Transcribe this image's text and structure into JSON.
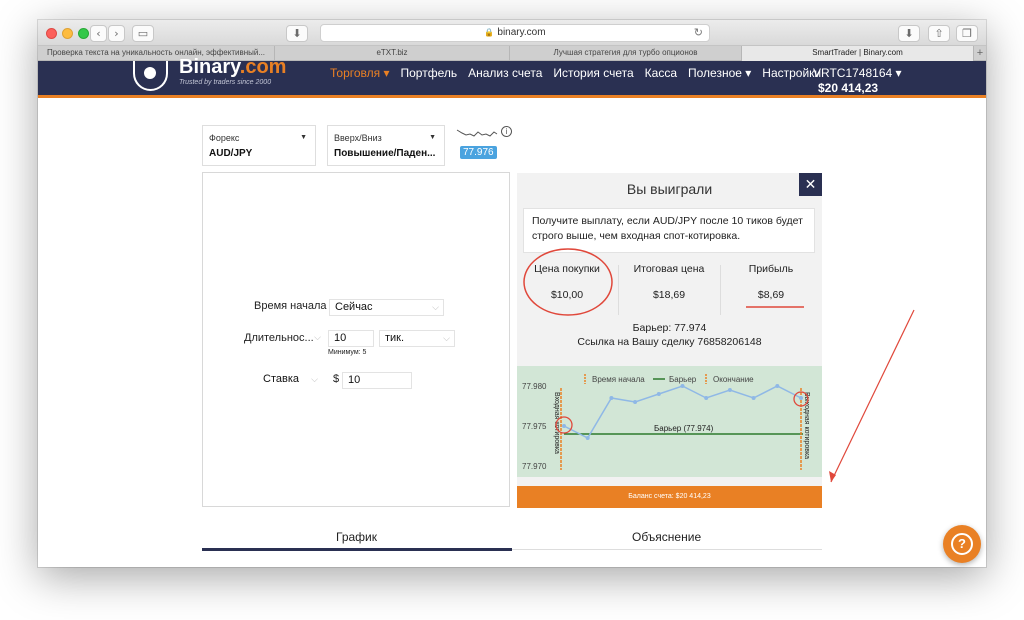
{
  "browser": {
    "address": "binary.com",
    "tabs": [
      {
        "label": "Проверка текста на уникальность онлайн, эффективный..."
      },
      {
        "label": "eTXT.biz"
      },
      {
        "label": "Лучшая стратегия для турбо опционов"
      },
      {
        "label": "SmartTrader | Binary.com"
      }
    ]
  },
  "header": {
    "brand": "Binary",
    "brand_suffix": ".com",
    "tagline": "Trusted by traders since 2000",
    "nav": [
      "Торговля ▾",
      "Портфель",
      "Анализ счета",
      "История счета",
      "Касса",
      "Полезное ▾",
      "Настройки"
    ],
    "account_id": "VRTC1748164  ▾",
    "balance": "$20 414,23"
  },
  "trade": {
    "market_label": "Форекс",
    "market_value": "AUD/JPY",
    "type_label": "Вверх/Вниз",
    "type_value": "Повышение/Паден...",
    "spot": "77.976",
    "start_label": "Время начала",
    "start_value": "Сейчас",
    "duration_label": "Длительнос...",
    "duration_value": "10",
    "duration_unit": "тик.",
    "minimum": "Минимум: 5",
    "stake_label": "Ставка",
    "currency": "$",
    "stake_value": "10"
  },
  "result": {
    "title": "Вы выиграли",
    "close": "✕",
    "description": "Получите выплату, если AUD/JPY после 10 тиков будет строго выше, чем входная спот-котировка.",
    "purchase_label": "Цена покупки",
    "purchase_value": "$10,00",
    "final_label": "Итоговая цена",
    "final_value": "$18,69",
    "profit_label": "Прибыль",
    "profit_value": "$8,69",
    "barrier": "Барьер: 77.974",
    "contract": "Ссылка на Вашу сделку 76858206148",
    "balance_bar": "Баланс счета: $20 414,23"
  },
  "chart_data": {
    "type": "line",
    "legend": [
      "Время начала",
      "Барьер",
      "Окончание"
    ],
    "y_ticks": [
      "77.980",
      "77.975",
      "77.970"
    ],
    "ylim": [
      77.9695,
      77.9815
    ],
    "barrier_value": 77.974,
    "barrier_label": "Барьер (77.974)",
    "entry_label": "Входная котировка",
    "exit_label": "Выходная котировка",
    "ticks": [
      77.975,
      77.9735,
      77.9785,
      77.978,
      77.979,
      77.98,
      77.9785,
      77.9795,
      77.9785,
      77.98,
      77.9785
    ],
    "colors": {
      "line": "#8fb8e6",
      "barrier": "#2d7a2d",
      "start": "#e98024",
      "end": "#e98024"
    }
  },
  "bottom_tabs": [
    "График",
    "Объяснение"
  ],
  "help": "?"
}
